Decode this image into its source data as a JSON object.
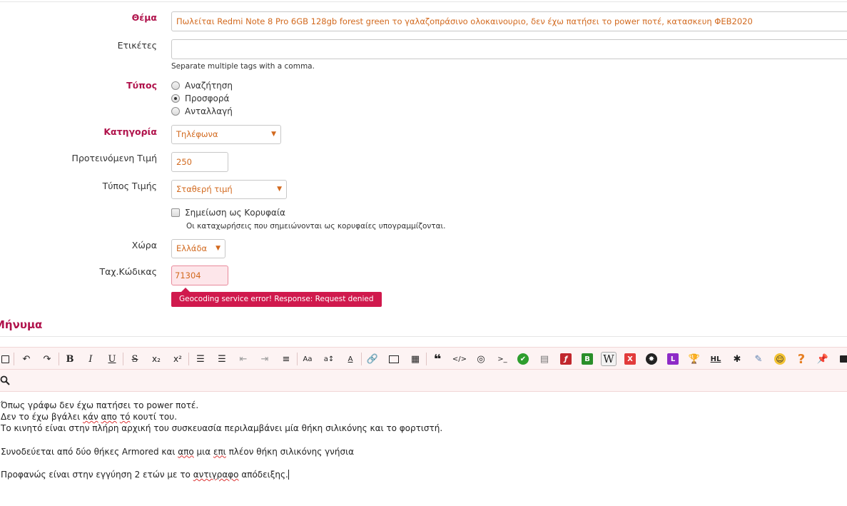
{
  "form": {
    "subject": {
      "label": "Θέμα",
      "value": "Πωλείται Redmi Note 8 Pro 6GB 128gb forest green το γαλαζοπράσινο ολοκαινουριο, δεν έχω πατήσει το power ποτέ, κατασκευη ΦΕΒ2020"
    },
    "tags": {
      "label": "Ετικέτες",
      "value": "",
      "hint": "Separate multiple tags with a comma."
    },
    "type": {
      "label": "Τύπος",
      "options": [
        "Αναζήτηση",
        "Προσφορά",
        "Ανταλλαγή"
      ],
      "selected": "Προσφορά"
    },
    "category": {
      "label": "Κατηγορία",
      "value": "Τηλέφωνα"
    },
    "price": {
      "label": "Προτεινόμενη Τιμή",
      "value": "250"
    },
    "price_type": {
      "label": "Τύπος Τιμής",
      "value": "Σταθερή τιμή"
    },
    "featured": {
      "label": "Σημείωση ως Κορυφαία",
      "checked": false,
      "hint": "Οι καταχωρήσεις που σημειώνονται ως κορυφαίες υπογραμμίζονται."
    },
    "country": {
      "label": "Χώρα",
      "value": "Ελλάδα"
    },
    "postcode": {
      "label": "Ταχ.Κώδικας",
      "value": "71304",
      "error": "Geocoding service error! Response: Request denied"
    }
  },
  "message": {
    "title": "Μήνυμα",
    "line1": "Όπως γράφω δεν έχω πατήσει το power ποτέ.",
    "line2": {
      "a": "Δεν το έχω βγάλει ",
      "w1": "κάν",
      "b": " ",
      "w2": "απο",
      "c": " ",
      "w3": "τό",
      "d": " κουτί του."
    },
    "line3": "Το κινητό είναι στην πλήρη αρχική του συσκευασία περιλαμβάνει μία θήκη σιλικόνης και το φορτιστή.",
    "line4": {
      "a": "Συνοδεύεται από δύο θήκες Armored και ",
      "w1": "απο",
      "b": " μια ",
      "w2": "επι",
      "c": " πλέον θήκη σιλικόνης γνήσια"
    },
    "line5": {
      "a": "Προφανώς είναι στην εγγύηση 2 ετών με το ",
      "w1": "αντιγραφο",
      "b": " απόδειξης."
    }
  },
  "toolbar": {
    "icons": [
      "checkbox-icon",
      "undo-icon",
      "redo-icon",
      "bold-icon",
      "italic-icon",
      "underline-icon",
      "strikethrough-icon",
      "subscript-icon",
      "superscript-icon",
      "ordered-list-icon",
      "bullet-list-icon",
      "outdent-icon",
      "indent-icon",
      "align-icon",
      "font-size-icon",
      "line-height-icon",
      "font-color-icon",
      "link-icon",
      "image-icon",
      "table-icon",
      "quote-icon",
      "code-icon",
      "spoiler-icon",
      "terminal-icon",
      "check-icon",
      "folder-icon",
      "flash-icon",
      "b-icon",
      "wikipedia-icon",
      "x-icon",
      "bomb-icon",
      "l-icon",
      "trophy-icon",
      "hl-icon",
      "puzzle-icon",
      "wand-icon",
      "smiley-icon",
      "help-icon",
      "pin-icon",
      "more-icon",
      "search-icon"
    ],
    "labels": {
      "bold": "B",
      "italic": "I",
      "underline": "U",
      "strike": "S",
      "sub": "x₂",
      "sup": "x²",
      "font_size": "Aa",
      "line_height": "a↕",
      "font_color": "A",
      "code": "</>",
      "terminal": ">_",
      "b_badge": "B",
      "wiki": "W",
      "x_badge": "X",
      "l_badge": "L",
      "hl": "HL",
      "help": "?"
    },
    "colors": {
      "check": "#2e9e2e",
      "flash": "#c1272d",
      "b_badge": "#2a8f2a",
      "x_badge": "#e23b3b",
      "l_badge": "#8e2bc7",
      "help": "#e67e22"
    }
  }
}
